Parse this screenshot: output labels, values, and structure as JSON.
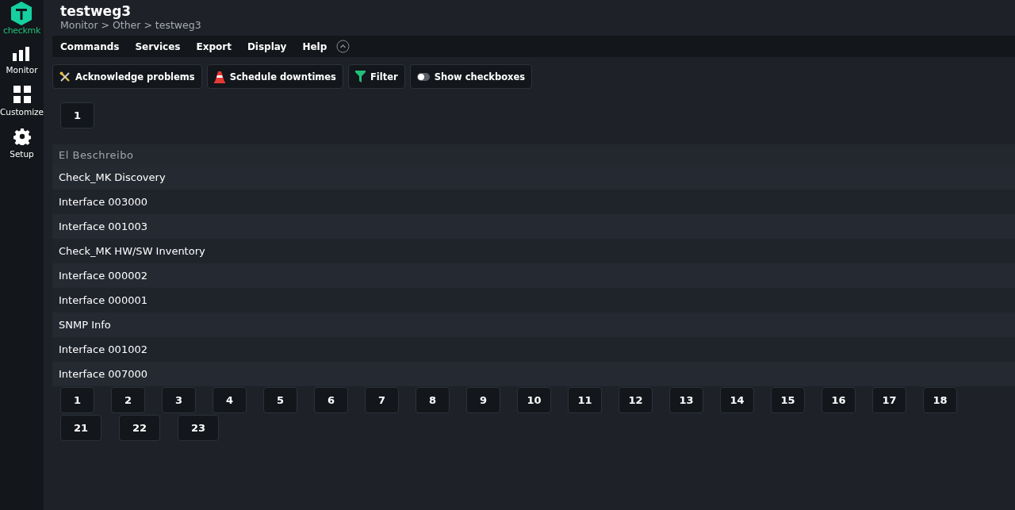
{
  "sidebar": {
    "logo": "checkmk",
    "items": [
      {
        "label": "Monitor",
        "kind": "monitor"
      },
      {
        "label": "Customize",
        "kind": "customize"
      },
      {
        "label": "Setup",
        "kind": "setup"
      }
    ]
  },
  "header": {
    "title": "testweg3",
    "breadcrumb": "Monitor > Other > testweg3"
  },
  "menu": [
    "Commands",
    "Services",
    "Export",
    "Display",
    "Help"
  ],
  "toolbar": [
    {
      "label": "Acknowledge problems",
      "kind": "acknowledge"
    },
    {
      "label": "Schedule downtimes",
      "kind": "downtime"
    },
    {
      "label": "Filter",
      "kind": "filter"
    },
    {
      "label": "Show checkboxes",
      "kind": "toggle"
    }
  ],
  "top_pages": [
    "1"
  ],
  "table": {
    "columns": [
      "El Beschreibo"
    ],
    "rows": [
      [
        "Check_MK Discovery"
      ],
      [
        "Interface 003000"
      ],
      [
        "Interface 001003"
      ],
      [
        "Check_MK HW/SW Inventory"
      ],
      [
        "Interface 000002"
      ],
      [
        "Interface 000001"
      ],
      [
        "SNMP Info"
      ],
      [
        "Interface 001002"
      ],
      [
        "Interface 007000"
      ]
    ]
  },
  "bottom_pages": [
    [
      "1",
      "2",
      "3",
      "4",
      "5",
      "6",
      "7",
      "8",
      "9",
      "10",
      "11",
      "12",
      "13",
      "14",
      "15",
      "16",
      "17",
      "18"
    ],
    [
      "21",
      "22",
      "23"
    ]
  ]
}
